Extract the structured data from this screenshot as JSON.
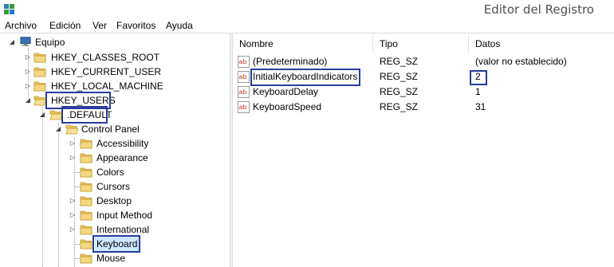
{
  "window": {
    "title": "Editor del Registro"
  },
  "menu": [
    "Archivo",
    "Edición",
    "Ver",
    "Favoritos",
    "Ayuda"
  ],
  "tree": {
    "root": "Equipo",
    "hives": [
      "HKEY_CLASSES_ROOT",
      "HKEY_CURRENT_USER",
      "HKEY_LOCAL_MACHINE",
      "HKEY_USERS"
    ],
    "default_key": ".DEFAULT",
    "control_panel": "Control Panel",
    "children": [
      "Accessibility",
      "Appearance",
      "Colors",
      "Cursors",
      "Desktop",
      "Input Method",
      "International",
      "Keyboard",
      "Mouse"
    ],
    "selected": "Keyboard"
  },
  "list": {
    "columns": [
      "Nombre",
      "Tipo",
      "Datos"
    ],
    "rows": [
      {
        "name": "(Predeterminado)",
        "type": "REG_SZ",
        "data": "(valor no establecido)"
      },
      {
        "name": "InitialKeyboardIndicators",
        "type": "REG_SZ",
        "data": "2"
      },
      {
        "name": "KeyboardDelay",
        "type": "REG_SZ",
        "data": "1"
      },
      {
        "name": "KeyboardSpeed",
        "type": "REG_SZ",
        "data": "31"
      }
    ]
  },
  "colors": {
    "highlight_box": "#2a3b9e",
    "selection": "#cce8ff",
    "folder": "#e8c25a"
  }
}
